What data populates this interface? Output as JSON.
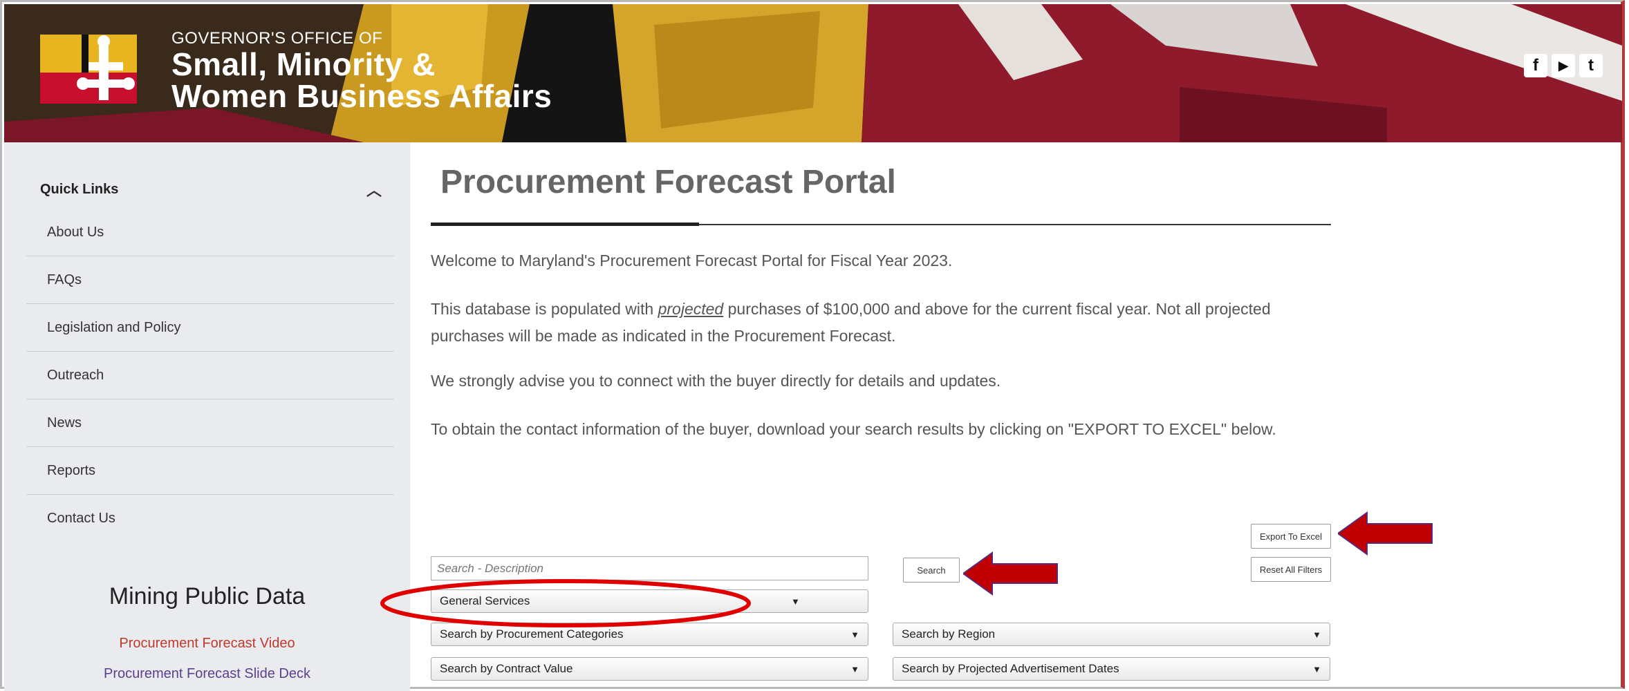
{
  "header": {
    "office_line": "GOVERNOR'S OFFICE OF",
    "title_line1": "Small, Minority &",
    "title_line2": "Women Business Affairs",
    "social_icons": [
      "facebook-icon",
      "youtube-icon",
      "twitter-icon"
    ],
    "social_glyphs": [
      "f",
      "▶",
      "t"
    ]
  },
  "sidebar": {
    "quick_links_label": "Quick Links",
    "items": [
      "About Us",
      "FAQs",
      "Legislation and Policy",
      "Outreach",
      "News",
      "Reports",
      "Contact Us"
    ],
    "mining_title": "Mining Public Data",
    "video_link": "Procurement Forecast Video",
    "slide_link": "Procurement Forecast Slide Deck"
  },
  "main": {
    "title": "Procurement Forecast Portal",
    "p1": "Welcome to Maryland's Procurement Forecast Portal for Fiscal Year 2023.",
    "p2_before": "This database is populated with ",
    "p2_em": "projected",
    "p2_after": " purchases of $100,000 and above for the current fiscal year. Not all projected purchases will be made as indicated in the Procurement Forecast.",
    "p3": "We strongly advise you to connect with the buyer directly for details and updates.",
    "p4": "To obtain the contact information of the buyer, download your search results by clicking on \"EXPORT TO EXCEL\" below."
  },
  "controls": {
    "export_label": "Export To Excel",
    "reset_label": "Reset All Filters",
    "search_label": "Search",
    "search_placeholder": "Search - Description",
    "general_select": "General Services",
    "category_select": "Search by Procurement Categories",
    "region_select": "Search by Region",
    "value_select": "Search by Contract Value",
    "dates_select": "Search by Projected Advertisement Dates"
  },
  "colors": {
    "annotation_red": "#c00000",
    "link_red": "#c0392b",
    "link_purple": "#5b3f8c",
    "sidebar_bg": "#e9ebef"
  }
}
